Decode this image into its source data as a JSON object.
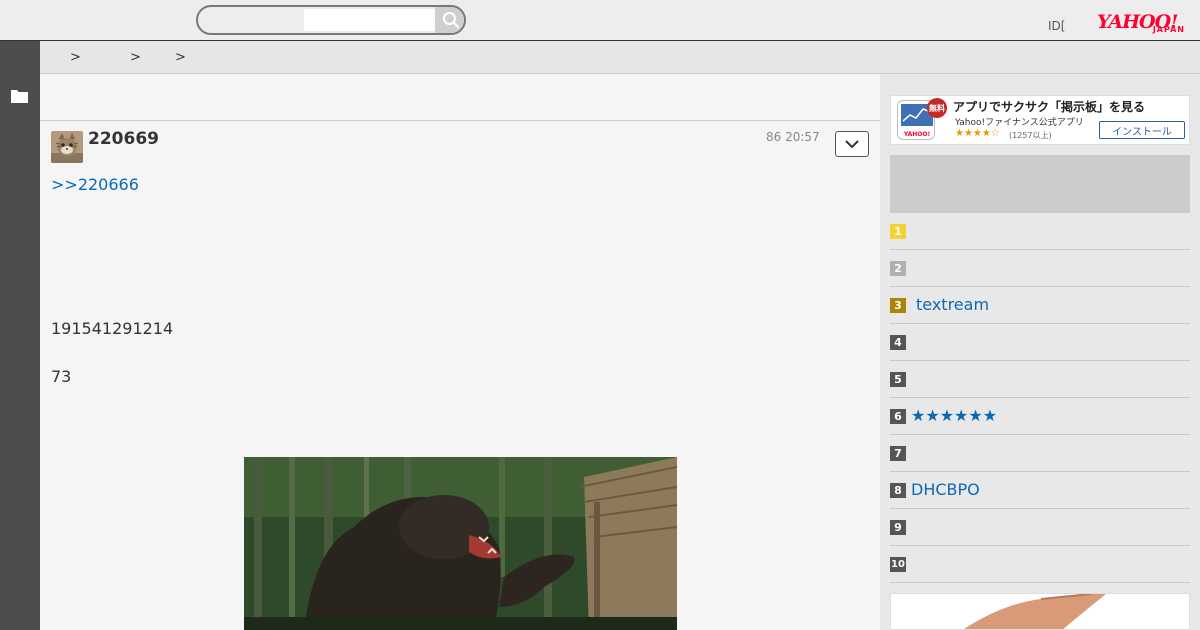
{
  "header": {
    "search_placeholder": "",
    "id_text": "ID[",
    "dot_text": "•",
    "logo_main": "YAHOO!",
    "logo_sub": "JAPAN"
  },
  "breadcrumb": {
    "separators": [
      ">",
      ">",
      ">"
    ]
  },
  "post": {
    "number": "220669",
    "time": "86 20:57",
    "reply_link": ">>220666",
    "line1": "191541291214",
    "line2": "73"
  },
  "ad": {
    "badge": "無料",
    "title": "アプリでサクサク「掲示板」を見る",
    "subtitle": "Yahoo!ファイナンス公式アプリ",
    "stars": "★★★★☆",
    "count": "(1257以上)",
    "install": "インストール"
  },
  "ranking": [
    {
      "rank": "1",
      "label": "",
      "color": "#f2d335"
    },
    {
      "rank": "2",
      "label": "",
      "color": "#b0b0b0"
    },
    {
      "rank": "3",
      "label": "textream",
      "color": "#a8860a"
    },
    {
      "rank": "4",
      "label": "",
      "color": "#555555"
    },
    {
      "rank": "5",
      "label": "",
      "color": "#555555"
    },
    {
      "rank": "6",
      "label": "★★★★★★",
      "color": "#555555"
    },
    {
      "rank": "7",
      "label": "",
      "color": "#555555"
    },
    {
      "rank": "8",
      "label": "DHCBPO",
      "color": "#555555"
    },
    {
      "rank": "9",
      "label": "",
      "color": "#555555"
    },
    {
      "rank": "10",
      "label": "",
      "color": "#555555"
    }
  ],
  "colors": {
    "link": "#0b68b5",
    "yahoo_red": "#ff0033",
    "rail": "#4d4d4d"
  }
}
